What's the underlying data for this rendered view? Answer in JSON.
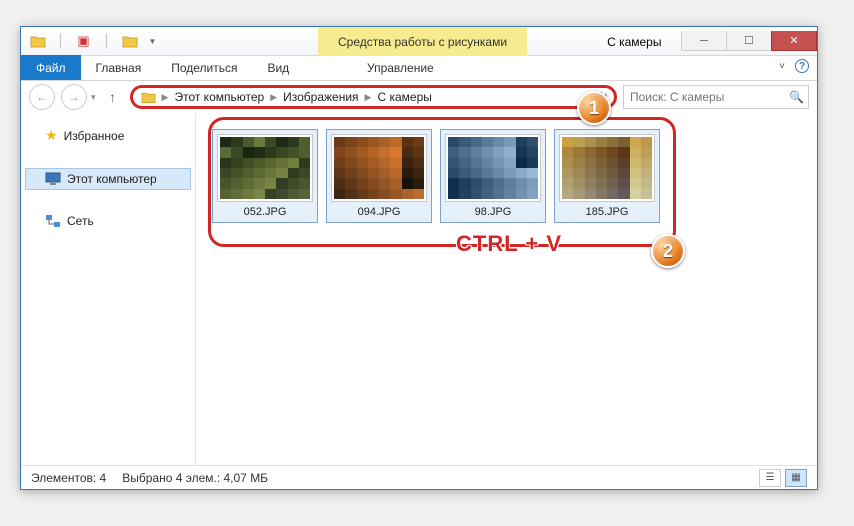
{
  "title_tab_pic_tools": "Средства работы с рисунками",
  "window_title": "С камеры",
  "ribbon": {
    "file": "Файл",
    "home": "Главная",
    "share": "Поделиться",
    "view": "Вид",
    "manage": "Управление"
  },
  "breadcrumbs": {
    "root": "Этот компьютер",
    "pictures": "Изображения",
    "folder": "С камеры"
  },
  "search": {
    "placeholder": "Поиск: С камеры"
  },
  "nav": {
    "favorites": "Избранное",
    "this_pc": "Этот компьютер",
    "network": "Сеть"
  },
  "files": [
    {
      "name": "052.JPG"
    },
    {
      "name": "094.JPG"
    },
    {
      "name": "98.JPG"
    },
    {
      "name": "185.JPG"
    }
  ],
  "annot_text": "CTRL + V",
  "status": {
    "count": "Элементов: 4",
    "selection": "Выбрано 4 элем.: 4,07 МБ"
  },
  "markers": {
    "one": "1",
    "two": "2"
  },
  "thumb_palettes": {
    "a": [
      "#1d2914",
      "#2d3a1e",
      "#4a5a2e",
      "#6a7a3e",
      "#3a4a24",
      "#1e2a16",
      "#2b3a1c",
      "#4f5f30",
      "#5a6a38",
      "#3b4a26",
      "#1a2412",
      "#202c16",
      "#2c3a1c",
      "#384622",
      "#445228",
      "#505e2e",
      "#2a361c",
      "#36421e",
      "#424e24",
      "#4e5a2a",
      "#5a6630",
      "#667236",
      "#727e3c",
      "#2e3a1e",
      "#3a4624",
      "#46522a",
      "#525e30",
      "#5e6a36",
      "#6a763c",
      "#768242",
      "#303c20",
      "#3c4826",
      "#48542c",
      "#546032",
      "#606c38",
      "#6c783e",
      "#788444",
      "#323e22",
      "#3e4a28",
      "#4a562e",
      "#566234",
      "#626e3a",
      "#6e7a40",
      "#7a8646",
      "#34402a",
      "#404c30",
      "#4c5836",
      "#58643c"
    ],
    "b": [
      "#6b3a14",
      "#7a4418",
      "#8a4e1c",
      "#9a5820",
      "#aa6224",
      "#ba6c28",
      "#5a3212",
      "#6c3c16",
      "#7e461a",
      "#90501e",
      "#a25a22",
      "#b46426",
      "#c66e2a",
      "#d8782e",
      "#4a2a10",
      "#5c3414",
      "#6e3e18",
      "#80481c",
      "#925220",
      "#a45c24",
      "#b66628",
      "#c8702c",
      "#3a220e",
      "#4c2c12",
      "#5e3616",
      "#70401a",
      "#824a1e",
      "#945422",
      "#a65e26",
      "#b8682a",
      "#2a1a0c",
      "#3c2410",
      "#4e2e14",
      "#603818",
      "#72421c",
      "#844c20",
      "#965624",
      "#a86028",
      "#1a120a",
      "#2c1c0e",
      "#3e2612",
      "#503016",
      "#623a1a",
      "#74441e",
      "#864e22",
      "#985826",
      "#aa622a",
      "#bc6c2e"
    ],
    "c": [
      "#2a4a6a",
      "#3a5a7a",
      "#4a6a8a",
      "#5a7a9a",
      "#6a8aaa",
      "#7a9aba",
      "#1f3f5f",
      "#2f4f6f",
      "#3f5f7f",
      "#4f6f8f",
      "#5f7f9f",
      "#6f8faf",
      "#7f9fbf",
      "#8fafcf",
      "#143454",
      "#244464",
      "#345474",
      "#446484",
      "#547494",
      "#6484a4",
      "#7494b4",
      "#84a4c4",
      "#092949",
      "#193959",
      "#294969",
      "#395979",
      "#496989",
      "#597999",
      "#6989a9",
      "#7999b9",
      "#89a9c9",
      "#99b9d9",
      "#0e2e4e",
      "#1e3e5e",
      "#2e4e6e",
      "#3e5e7e",
      "#4e6e8e",
      "#5e7e9e",
      "#6e8eae",
      "#7e9ebe",
      "#132f4f",
      "#23415f",
      "#33516f",
      "#43617f",
      "#53718f",
      "#63819f",
      "#7391af",
      "#83a1bf"
    ],
    "d": [
      "#caa040",
      "#baa050",
      "#aa9048",
      "#9a8040",
      "#8a7038",
      "#7a6030",
      "#cca850",
      "#bc9848",
      "#ac8840",
      "#9c7838",
      "#8c6830",
      "#7c5828",
      "#6c4820",
      "#5c3818",
      "#cdb060",
      "#bda058",
      "#ad9050",
      "#9d8048",
      "#8d7040",
      "#7d6038",
      "#6d5030",
      "#5d4028",
      "#cfb870",
      "#bfa868",
      "#af9860",
      "#9f8858",
      "#8f7850",
      "#7f6848",
      "#6f5840",
      "#5f4838",
      "#d1c080",
      "#c1b078",
      "#b1a070",
      "#a19068",
      "#918060",
      "#817058",
      "#716050",
      "#615048",
      "#d3c890",
      "#c3b888",
      "#b3a880",
      "#a39878",
      "#938870",
      "#837868",
      "#736860",
      "#635858",
      "#d5d0a0",
      "#c5c098"
    ]
  }
}
